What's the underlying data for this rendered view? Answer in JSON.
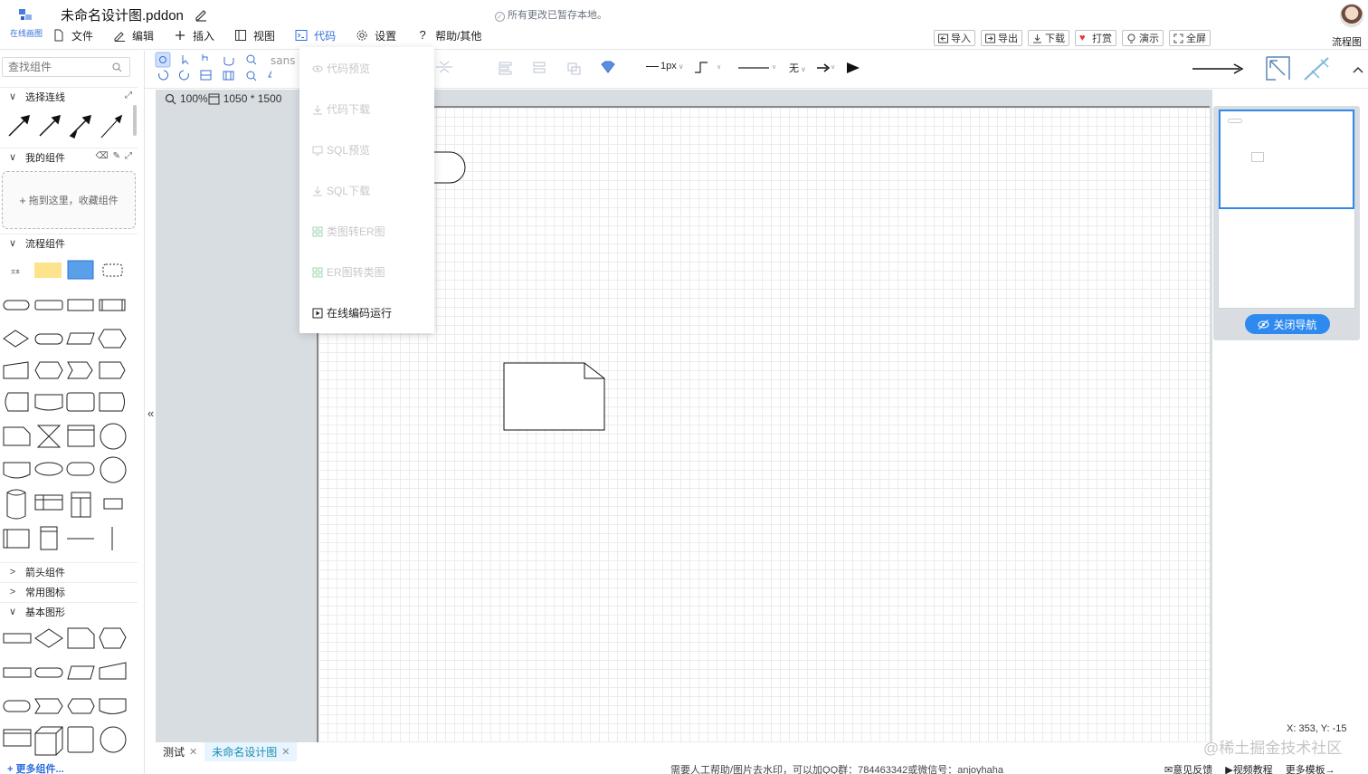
{
  "app": {
    "logo_text": "在线画图",
    "doc_title": "未命名设计图.pddon",
    "save_status": "所有更改已暂存本地。",
    "user_label": "流程图"
  },
  "menubar": [
    {
      "label": "文件",
      "icon": "file-icon"
    },
    {
      "label": "编辑",
      "icon": "edit-icon"
    },
    {
      "label": "插入",
      "icon": "plus-icon"
    },
    {
      "label": "视图",
      "icon": "view-icon"
    },
    {
      "label": "代码",
      "icon": "code-icon",
      "active": true
    },
    {
      "label": "设置",
      "icon": "gear-icon"
    },
    {
      "label": "帮助/其他",
      "icon": "help-icon"
    }
  ],
  "actions": [
    {
      "label": "导入",
      "icon": "import-icon"
    },
    {
      "label": "导出",
      "icon": "export-icon"
    },
    {
      "label": "下载",
      "icon": "download-icon"
    },
    {
      "label": "打赏",
      "icon": "heart-icon"
    },
    {
      "label": "演示",
      "icon": "bulb-icon"
    },
    {
      "label": "全屏",
      "icon": "fullscreen-icon"
    }
  ],
  "sidebar": {
    "search_placeholder": "查找组件",
    "sections": {
      "connectors": "选择连线",
      "my_components": "我的组件",
      "flow": "流程组件",
      "arrows": "箭头组件",
      "icons": "常用图标",
      "basic": "基本图形"
    },
    "drop_zone": "拖到这里，收藏组件",
    "more": "更多组件..."
  },
  "toolbar": {
    "font": "sans",
    "stroke_width": "1px",
    "arrow_start": "无"
  },
  "canvas": {
    "zoom": "100%",
    "size": "1050 * 1500",
    "coords": "X: 353, Y: -15"
  },
  "code_menu": [
    {
      "label": "代码预览",
      "disabled": true
    },
    {
      "label": "代码下载",
      "disabled": true
    },
    {
      "label": "SQL预览",
      "disabled": true
    },
    {
      "label": "SQL下载",
      "disabled": true
    },
    {
      "label": "类图转ER图",
      "disabled": true
    },
    {
      "label": "ER图转类图",
      "disabled": true
    },
    {
      "label": "在线编码运行",
      "disabled": false
    }
  ],
  "navigator": {
    "close_label": "关闭导航"
  },
  "page_tabs": [
    {
      "label": "测试",
      "active": false
    },
    {
      "label": "未命名设计图",
      "active": true
    }
  ],
  "footer": {
    "message": "需要人工帮助/图片去水印，可以加QQ群：784463342或微信号：anjoyhaha",
    "links": [
      "意见反馈",
      "视频教程",
      "更多模板→"
    ]
  },
  "watermark": "@稀土掘金技术社区",
  "colors": {
    "accent": "#2f6fde",
    "nav_button": "#2f8af0",
    "tab_active_bg": "#e8f4ff"
  }
}
